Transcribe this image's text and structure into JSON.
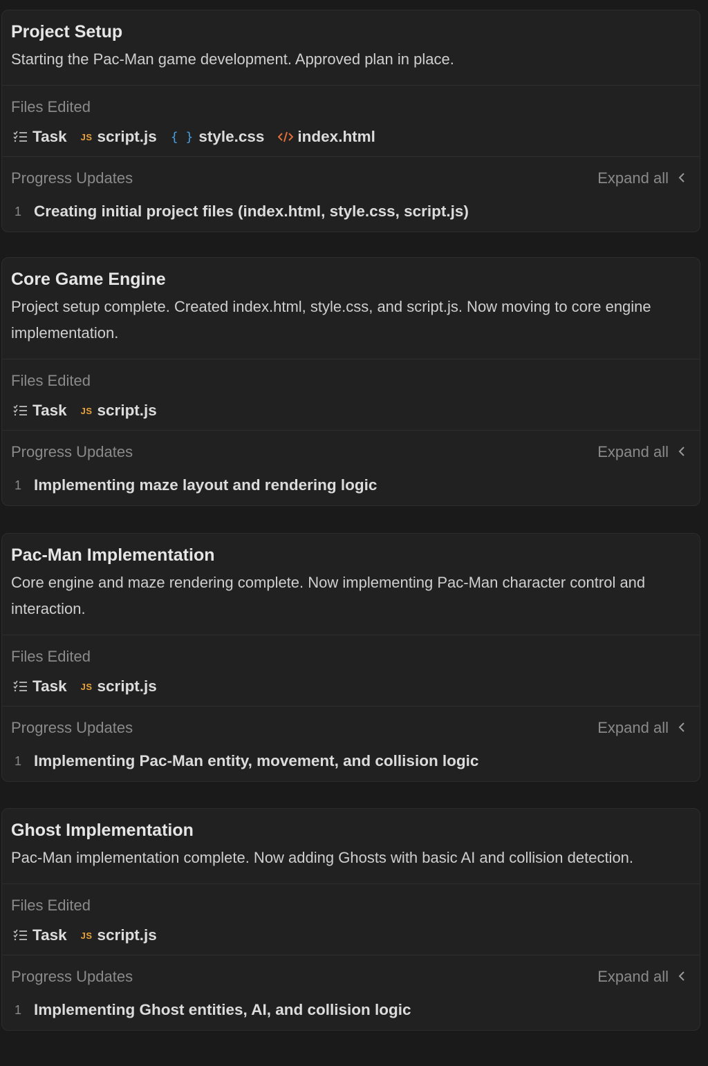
{
  "cards": [
    {
      "title": "Project Setup",
      "description": "Starting the Pac-Man game development. Approved plan in place.",
      "files_label": "Files Edited",
      "files": [
        {
          "name": "Task",
          "icon": "task-list-icon"
        },
        {
          "name": "script.js",
          "icon": "js-icon",
          "icon_text": "JS"
        },
        {
          "name": "style.css",
          "icon": "css-braces-icon",
          "icon_text": "{ }"
        },
        {
          "name": "index.html",
          "icon": "html-code-icon"
        }
      ],
      "progress_label": "Progress Updates",
      "expand_label": "Expand all",
      "updates": [
        {
          "num": "1",
          "text": "Creating initial project files (index.html, style.css, script.js)"
        }
      ]
    },
    {
      "title": "Core Game Engine",
      "description": "Project setup complete. Created index.html, style.css, and script.js. Now moving to core engine implementation.",
      "files_label": "Files Edited",
      "files": [
        {
          "name": "Task",
          "icon": "task-list-icon"
        },
        {
          "name": "script.js",
          "icon": "js-icon",
          "icon_text": "JS"
        }
      ],
      "progress_label": "Progress Updates",
      "expand_label": "Expand all",
      "updates": [
        {
          "num": "1",
          "text": "Implementing maze layout and rendering logic"
        }
      ]
    },
    {
      "title": "Pac-Man Implementation",
      "description": "Core engine and maze rendering complete. Now implementing Pac-Man character control and interaction.",
      "files_label": "Files Edited",
      "files": [
        {
          "name": "Task",
          "icon": "task-list-icon"
        },
        {
          "name": "script.js",
          "icon": "js-icon",
          "icon_text": "JS"
        }
      ],
      "progress_label": "Progress Updates",
      "expand_label": "Expand all",
      "updates": [
        {
          "num": "1",
          "text": "Implementing Pac-Man entity, movement, and collision logic"
        }
      ]
    },
    {
      "title": "Ghost Implementation",
      "description": "Pac-Man implementation complete. Now adding Ghosts with basic AI and collision detection.",
      "files_label": "Files Edited",
      "files": [
        {
          "name": "Task",
          "icon": "task-list-icon"
        },
        {
          "name": "script.js",
          "icon": "js-icon",
          "icon_text": "JS"
        }
      ],
      "progress_label": "Progress Updates",
      "expand_label": "Expand all",
      "updates": [
        {
          "num": "1",
          "text": "Implementing Ghost entities, AI, and collision logic"
        }
      ]
    }
  ],
  "colors": {
    "background": "#1a1a1a",
    "card": "#212121",
    "js": "#e8a33d",
    "css": "#4a9fe0",
    "html": "#e0703a"
  }
}
